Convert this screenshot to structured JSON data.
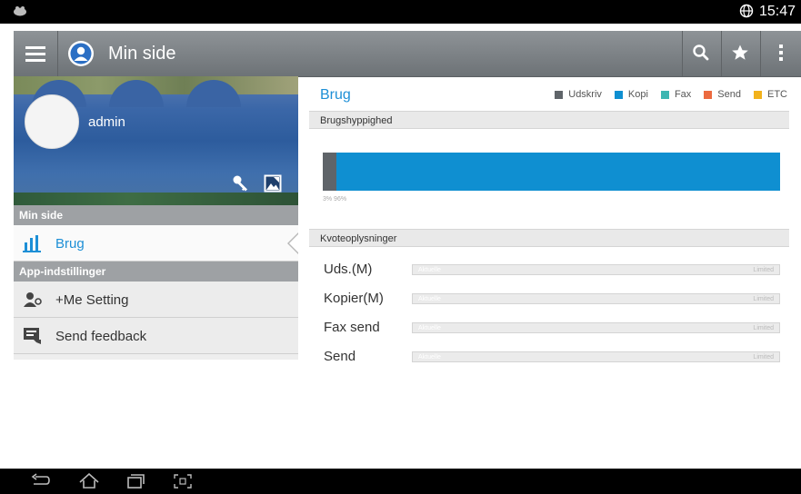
{
  "status_bar": {
    "time": "15:47",
    "icons": [
      "app-notification-icon",
      "globe-icon"
    ]
  },
  "app_bar": {
    "title": "Min side",
    "icons": [
      "menu-icon",
      "user-avatar-icon",
      "search-icon",
      "star-icon",
      "more-vert-icon"
    ]
  },
  "profile": {
    "username": "admin",
    "icons": [
      "key-icon",
      "edit-image-icon"
    ]
  },
  "sidebar": {
    "section_min_side": "Min side",
    "brug_label": "Brug",
    "section_app": "App-indstillinger",
    "me_setting_label": "+Me Setting",
    "send_feedback_label": "Send feedback"
  },
  "usage": {
    "title": "Brug",
    "legend": [
      {
        "label": "Udskriv",
        "color": "#5f6469"
      },
      {
        "label": "Kopi",
        "color": "#0f8fd1"
      },
      {
        "label": "Fax",
        "color": "#3cb6b2"
      },
      {
        "label": "Send",
        "color": "#ec6a3f"
      },
      {
        "label": "ETC",
        "color": "#f2b21c"
      }
    ],
    "frequency_header": "Brugshyppighed",
    "bar_caption": "3% 96%",
    "quota_header": "Kvoteoplysninger"
  },
  "chart_data": {
    "type": "bar",
    "orientation": "horizontal-stacked",
    "series": [
      {
        "name": "Udskriv",
        "value": 3
      },
      {
        "name": "Kopi",
        "value": 96
      },
      {
        "name": "Fax",
        "value": 0
      },
      {
        "name": "Send",
        "value": 0
      },
      {
        "name": "ETC",
        "value": 0
      }
    ],
    "unit": "%"
  },
  "quota": {
    "current_label": "Aktuelle",
    "limit_label": "Limited",
    "rows": [
      {
        "label": "Uds.(M)"
      },
      {
        "label": "Kopier(M)"
      },
      {
        "label": "Fax send"
      },
      {
        "label": "Send"
      }
    ]
  },
  "nav_bar": {
    "icons": [
      "back-icon",
      "home-icon",
      "recent-apps-icon",
      "screenshot-icon"
    ]
  }
}
